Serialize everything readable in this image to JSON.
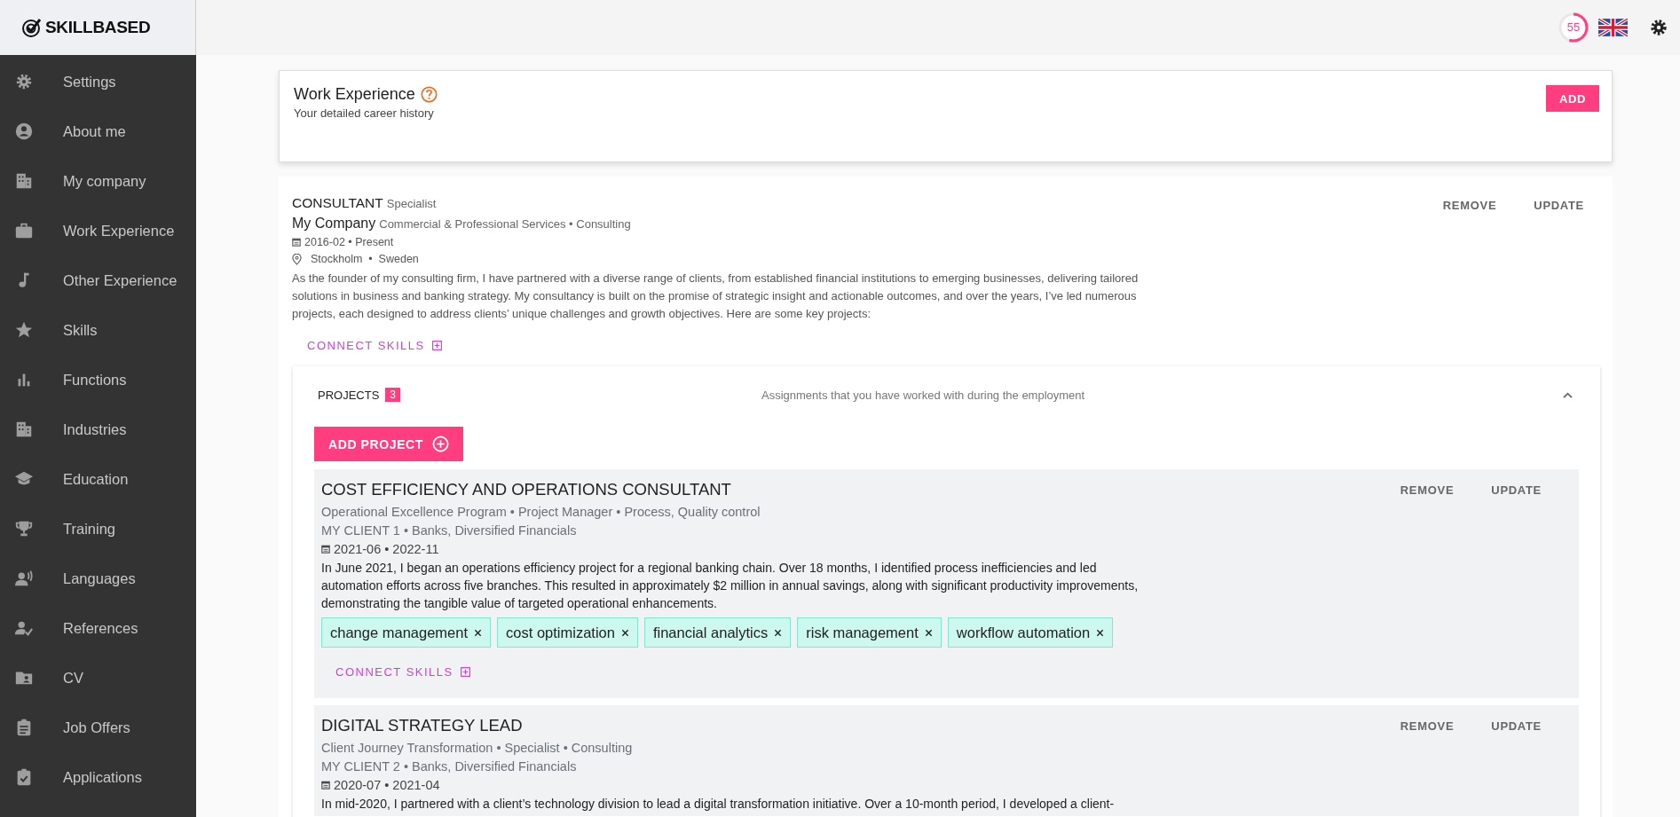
{
  "brand": {
    "name": "SKILLBASED"
  },
  "nav": [
    {
      "label": "Settings"
    },
    {
      "label": "About me"
    },
    {
      "label": "My company"
    },
    {
      "label": "Work Experience"
    },
    {
      "label": "Other Experience"
    },
    {
      "label": "Skills"
    },
    {
      "label": "Functions"
    },
    {
      "label": "Industries"
    },
    {
      "label": "Education"
    },
    {
      "label": "Training"
    },
    {
      "label": "Languages"
    },
    {
      "label": "References"
    },
    {
      "label": "CV"
    },
    {
      "label": "Job Offers"
    },
    {
      "label": "Applications"
    }
  ],
  "topbar": {
    "score": {
      "value": "55",
      "level": 0.55
    }
  },
  "section": {
    "title": "Work Experience",
    "subtitle": "Your detailed career history",
    "add_button": "ADD"
  },
  "positions": [
    {
      "title": "CONSULTANT",
      "seniority": "Specialist",
      "company": "My Company",
      "company_meta": "Commercial & Professional Services • Consulting",
      "dates": "2016-02 • Present",
      "location": "Stockholm  •  Sweden",
      "description": "As the founder of my consulting firm, I have partnered with a diverse range of clients, from established financial institutions to emerging businesses, delivering tailored solutions in business and banking strategy. My consultancy is built on the promise of strategic insight and actionable outcomes, and over the years, I’ve led numerous projects, each designed to address clients’ unique challenges and growth objectives. Here are some key projects:",
      "connect_skills": "CONNECT SKILLS",
      "remove": "REMOVE",
      "update": "UPDATE",
      "projects": {
        "label": "PROJECTS",
        "count": "3",
        "hint": "Assignments that you have worked with during the employment",
        "expanded": true,
        "add_button": "ADD PROJECT",
        "items": [
          {
            "title": "COST EFFICIENCY AND OPERATIONS CONSULTANT",
            "meta": "Operational Excellence Program • Project Manager • Process, Quality control",
            "client": "MY CLIENT 1 • Banks, Diversified Financials",
            "dates": "2021-06 • 2022-11",
            "description": "In June 2021, I began an operations efficiency project for a regional banking chain. Over 18 months, I identified process inefficiencies and led automation efforts across five branches. This resulted in approximately $2 million in annual savings, along with significant productivity improvements, demonstrating the tangible value of targeted operational enhancements.",
            "skills": [
              "change management",
              "cost optimization",
              "financial analytics",
              "risk management",
              "workflow automation"
            ],
            "connect_skills": "CONNECT SKILLS",
            "remove": "REMOVE",
            "update": "UPDATE"
          },
          {
            "title": "DIGITAL STRATEGY LEAD",
            "meta": "Client Journey Transformation • Specialist • Consulting",
            "client": "MY CLIENT 2 • Banks, Diversified Financials",
            "dates": "2020-07 • 2021-04",
            "description": "In mid-2020, I partnered with a client’s technology division to lead a digital transformation initiative. Over a 10-month period, I developed a client-",
            "remove": "REMOVE",
            "update": "UPDATE"
          }
        ]
      }
    }
  ]
}
